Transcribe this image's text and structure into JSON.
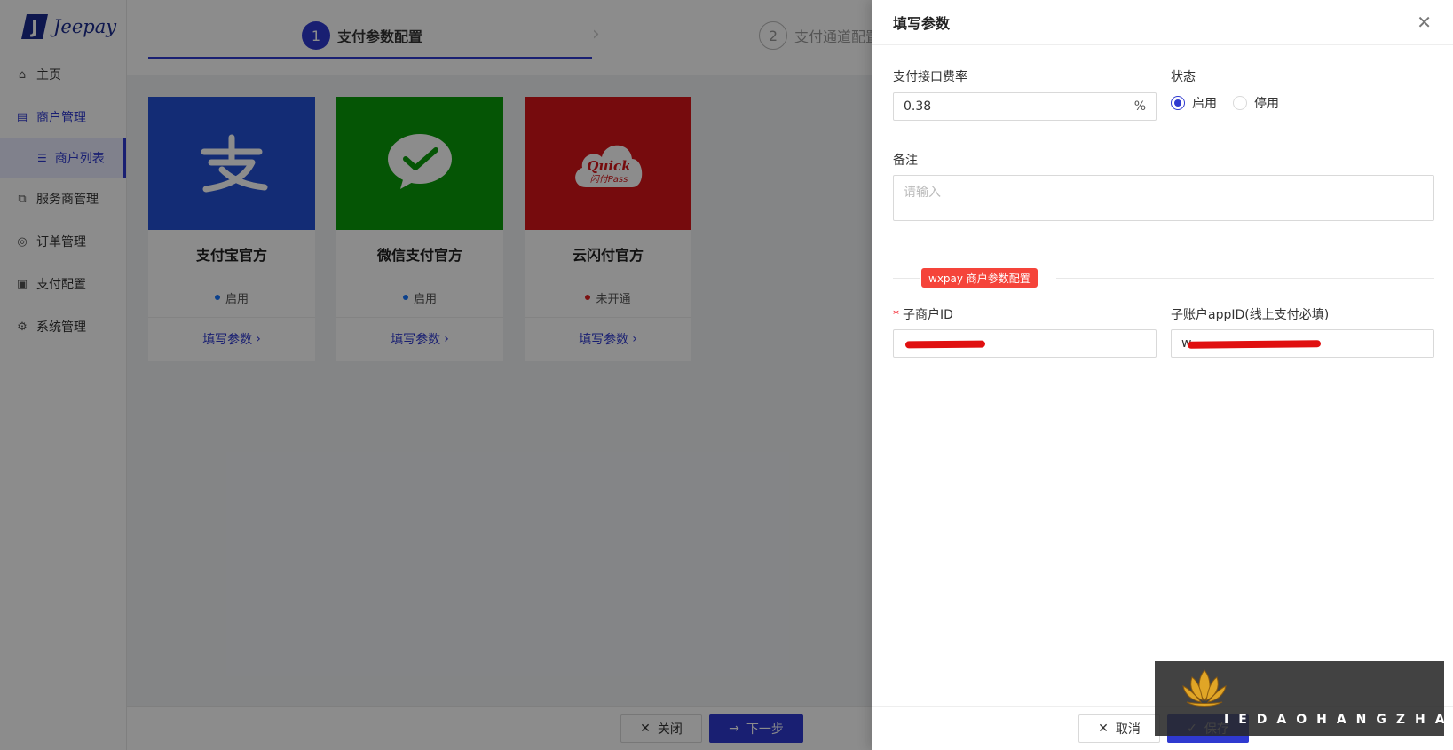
{
  "logo": {
    "mark": "J",
    "text": "Jeepay"
  },
  "sidebar": {
    "items": [
      {
        "label": "主页",
        "icon": "home-icon"
      },
      {
        "label": "商户管理",
        "icon": "shop-icon"
      },
      {
        "label": "商户列表",
        "icon": "list-icon"
      },
      {
        "label": "服务商管理",
        "icon": "copy-icon"
      },
      {
        "label": "订单管理",
        "icon": "order-icon"
      },
      {
        "label": "支付配置",
        "icon": "file-icon"
      },
      {
        "label": "系统管理",
        "icon": "gear-icon"
      }
    ]
  },
  "steps": {
    "step1": {
      "num": "1",
      "label": "支付参数配置"
    },
    "step2": {
      "num": "2",
      "label": "支付通道配置"
    }
  },
  "cards": [
    {
      "title": "支付宝官方",
      "status": "启用",
      "status_color": "#1677ff",
      "action": "填写参数",
      "color": "#2451d6",
      "icon": "alipay-icon"
    },
    {
      "title": "微信支付官方",
      "status": "启用",
      "status_color": "#1677ff",
      "action": "填写参数",
      "color": "#0a9b0a",
      "icon": "wechat-pay-icon"
    },
    {
      "title": "云闪付官方",
      "status": "未开通",
      "status_color": "#e02020",
      "action": "填写参数",
      "color": "#d71518",
      "icon": "quickpass-icon",
      "icon_text1": "Quick",
      "icon_text2": "闪付Pass"
    }
  ],
  "bottom_bar": {
    "close_label": "关闭",
    "next_label": "下一步"
  },
  "drawer": {
    "title": "填写参数",
    "fee": {
      "label": "支付接口费率",
      "value": "0.38",
      "suffix": "%"
    },
    "status": {
      "label": "状态",
      "on": "启用",
      "off": "停用"
    },
    "remark": {
      "label": "备注",
      "placeholder": "请输入"
    },
    "section_tag": "wxpay 商户参数配置",
    "sub_mch": {
      "label": "子商户ID",
      "required": "*"
    },
    "sub_appid": {
      "label": "子账户appID(线上支付必填)",
      "value_prefix": "w"
    },
    "footer": {
      "cancel_label": "取消",
      "save_label": "保存"
    }
  },
  "watermark": {
    "text": "IEDAOHANGZHAN"
  }
}
